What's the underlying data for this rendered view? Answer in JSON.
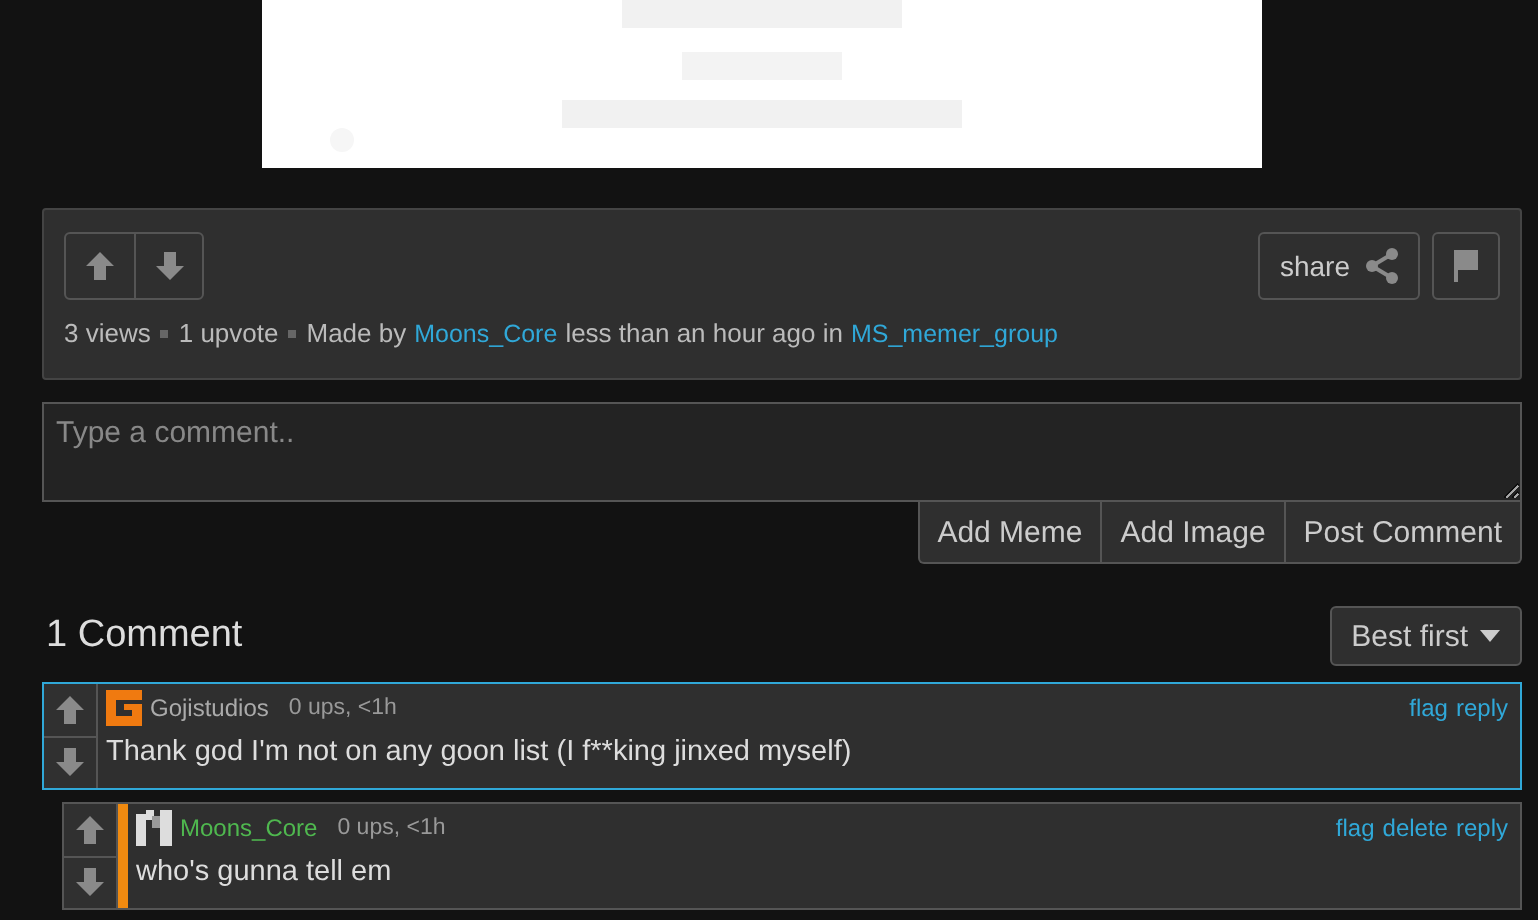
{
  "post": {
    "share_label": "share",
    "stats": [
      {
        "kind": "text",
        "text": "3 views"
      },
      {
        "kind": "text",
        "text": "1 upvote"
      }
    ],
    "made_by": "Made by",
    "author": "Moons_Core",
    "time": "less than an hour ago in",
    "group": "MS_memer_group"
  },
  "comment_field": {
    "placeholder": "Type a comment.."
  },
  "buttons": [
    "Add Meme",
    "Add Image",
    "Post Comment"
  ],
  "comments_heading": "1 Comment",
  "sort": {
    "label": "Best first"
  },
  "comments": [
    {
      "user": "Gojistudios",
      "avatar": {
        "kind": "orange-g"
      },
      "meta": "0 ups, <1h",
      "text": "Thank god I'm not on any goon list (I f**king jinxed myself)",
      "highlighted": true,
      "op": false,
      "actions": [
        "flag",
        "reply"
      ],
      "children": [
        {
          "user": "Moons_Core",
          "avatar": {
            "kind": "pixel-m"
          },
          "meta": "0 ups, <1h",
          "text": "who's gunna tell em",
          "highlighted": false,
          "op": true,
          "actions": [
            "flag",
            "delete",
            "reply"
          ]
        }
      ]
    }
  ]
}
